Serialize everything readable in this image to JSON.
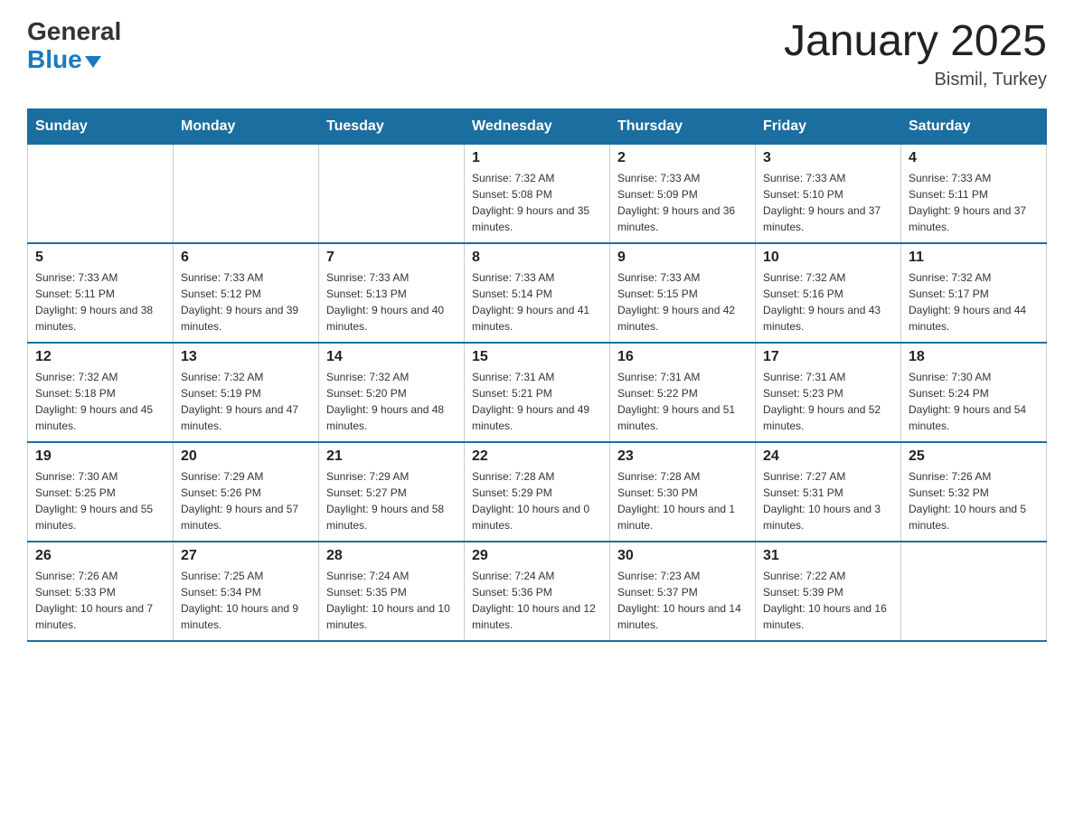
{
  "logo": {
    "general": "General",
    "blue": "Blue"
  },
  "title": "January 2025",
  "subtitle": "Bismil, Turkey",
  "days_of_week": [
    "Sunday",
    "Monday",
    "Tuesday",
    "Wednesday",
    "Thursday",
    "Friday",
    "Saturday"
  ],
  "weeks": [
    [
      {
        "day": "",
        "info": ""
      },
      {
        "day": "",
        "info": ""
      },
      {
        "day": "",
        "info": ""
      },
      {
        "day": "1",
        "info": "Sunrise: 7:32 AM\nSunset: 5:08 PM\nDaylight: 9 hours and 35 minutes."
      },
      {
        "day": "2",
        "info": "Sunrise: 7:33 AM\nSunset: 5:09 PM\nDaylight: 9 hours and 36 minutes."
      },
      {
        "day": "3",
        "info": "Sunrise: 7:33 AM\nSunset: 5:10 PM\nDaylight: 9 hours and 37 minutes."
      },
      {
        "day": "4",
        "info": "Sunrise: 7:33 AM\nSunset: 5:11 PM\nDaylight: 9 hours and 37 minutes."
      }
    ],
    [
      {
        "day": "5",
        "info": "Sunrise: 7:33 AM\nSunset: 5:11 PM\nDaylight: 9 hours and 38 minutes."
      },
      {
        "day": "6",
        "info": "Sunrise: 7:33 AM\nSunset: 5:12 PM\nDaylight: 9 hours and 39 minutes."
      },
      {
        "day": "7",
        "info": "Sunrise: 7:33 AM\nSunset: 5:13 PM\nDaylight: 9 hours and 40 minutes."
      },
      {
        "day": "8",
        "info": "Sunrise: 7:33 AM\nSunset: 5:14 PM\nDaylight: 9 hours and 41 minutes."
      },
      {
        "day": "9",
        "info": "Sunrise: 7:33 AM\nSunset: 5:15 PM\nDaylight: 9 hours and 42 minutes."
      },
      {
        "day": "10",
        "info": "Sunrise: 7:32 AM\nSunset: 5:16 PM\nDaylight: 9 hours and 43 minutes."
      },
      {
        "day": "11",
        "info": "Sunrise: 7:32 AM\nSunset: 5:17 PM\nDaylight: 9 hours and 44 minutes."
      }
    ],
    [
      {
        "day": "12",
        "info": "Sunrise: 7:32 AM\nSunset: 5:18 PM\nDaylight: 9 hours and 45 minutes."
      },
      {
        "day": "13",
        "info": "Sunrise: 7:32 AM\nSunset: 5:19 PM\nDaylight: 9 hours and 47 minutes."
      },
      {
        "day": "14",
        "info": "Sunrise: 7:32 AM\nSunset: 5:20 PM\nDaylight: 9 hours and 48 minutes."
      },
      {
        "day": "15",
        "info": "Sunrise: 7:31 AM\nSunset: 5:21 PM\nDaylight: 9 hours and 49 minutes."
      },
      {
        "day": "16",
        "info": "Sunrise: 7:31 AM\nSunset: 5:22 PM\nDaylight: 9 hours and 51 minutes."
      },
      {
        "day": "17",
        "info": "Sunrise: 7:31 AM\nSunset: 5:23 PM\nDaylight: 9 hours and 52 minutes."
      },
      {
        "day": "18",
        "info": "Sunrise: 7:30 AM\nSunset: 5:24 PM\nDaylight: 9 hours and 54 minutes."
      }
    ],
    [
      {
        "day": "19",
        "info": "Sunrise: 7:30 AM\nSunset: 5:25 PM\nDaylight: 9 hours and 55 minutes."
      },
      {
        "day": "20",
        "info": "Sunrise: 7:29 AM\nSunset: 5:26 PM\nDaylight: 9 hours and 57 minutes."
      },
      {
        "day": "21",
        "info": "Sunrise: 7:29 AM\nSunset: 5:27 PM\nDaylight: 9 hours and 58 minutes."
      },
      {
        "day": "22",
        "info": "Sunrise: 7:28 AM\nSunset: 5:29 PM\nDaylight: 10 hours and 0 minutes."
      },
      {
        "day": "23",
        "info": "Sunrise: 7:28 AM\nSunset: 5:30 PM\nDaylight: 10 hours and 1 minute."
      },
      {
        "day": "24",
        "info": "Sunrise: 7:27 AM\nSunset: 5:31 PM\nDaylight: 10 hours and 3 minutes."
      },
      {
        "day": "25",
        "info": "Sunrise: 7:26 AM\nSunset: 5:32 PM\nDaylight: 10 hours and 5 minutes."
      }
    ],
    [
      {
        "day": "26",
        "info": "Sunrise: 7:26 AM\nSunset: 5:33 PM\nDaylight: 10 hours and 7 minutes."
      },
      {
        "day": "27",
        "info": "Sunrise: 7:25 AM\nSunset: 5:34 PM\nDaylight: 10 hours and 9 minutes."
      },
      {
        "day": "28",
        "info": "Sunrise: 7:24 AM\nSunset: 5:35 PM\nDaylight: 10 hours and 10 minutes."
      },
      {
        "day": "29",
        "info": "Sunrise: 7:24 AM\nSunset: 5:36 PM\nDaylight: 10 hours and 12 minutes."
      },
      {
        "day": "30",
        "info": "Sunrise: 7:23 AM\nSunset: 5:37 PM\nDaylight: 10 hours and 14 minutes."
      },
      {
        "day": "31",
        "info": "Sunrise: 7:22 AM\nSunset: 5:39 PM\nDaylight: 10 hours and 16 minutes."
      },
      {
        "day": "",
        "info": ""
      }
    ]
  ]
}
